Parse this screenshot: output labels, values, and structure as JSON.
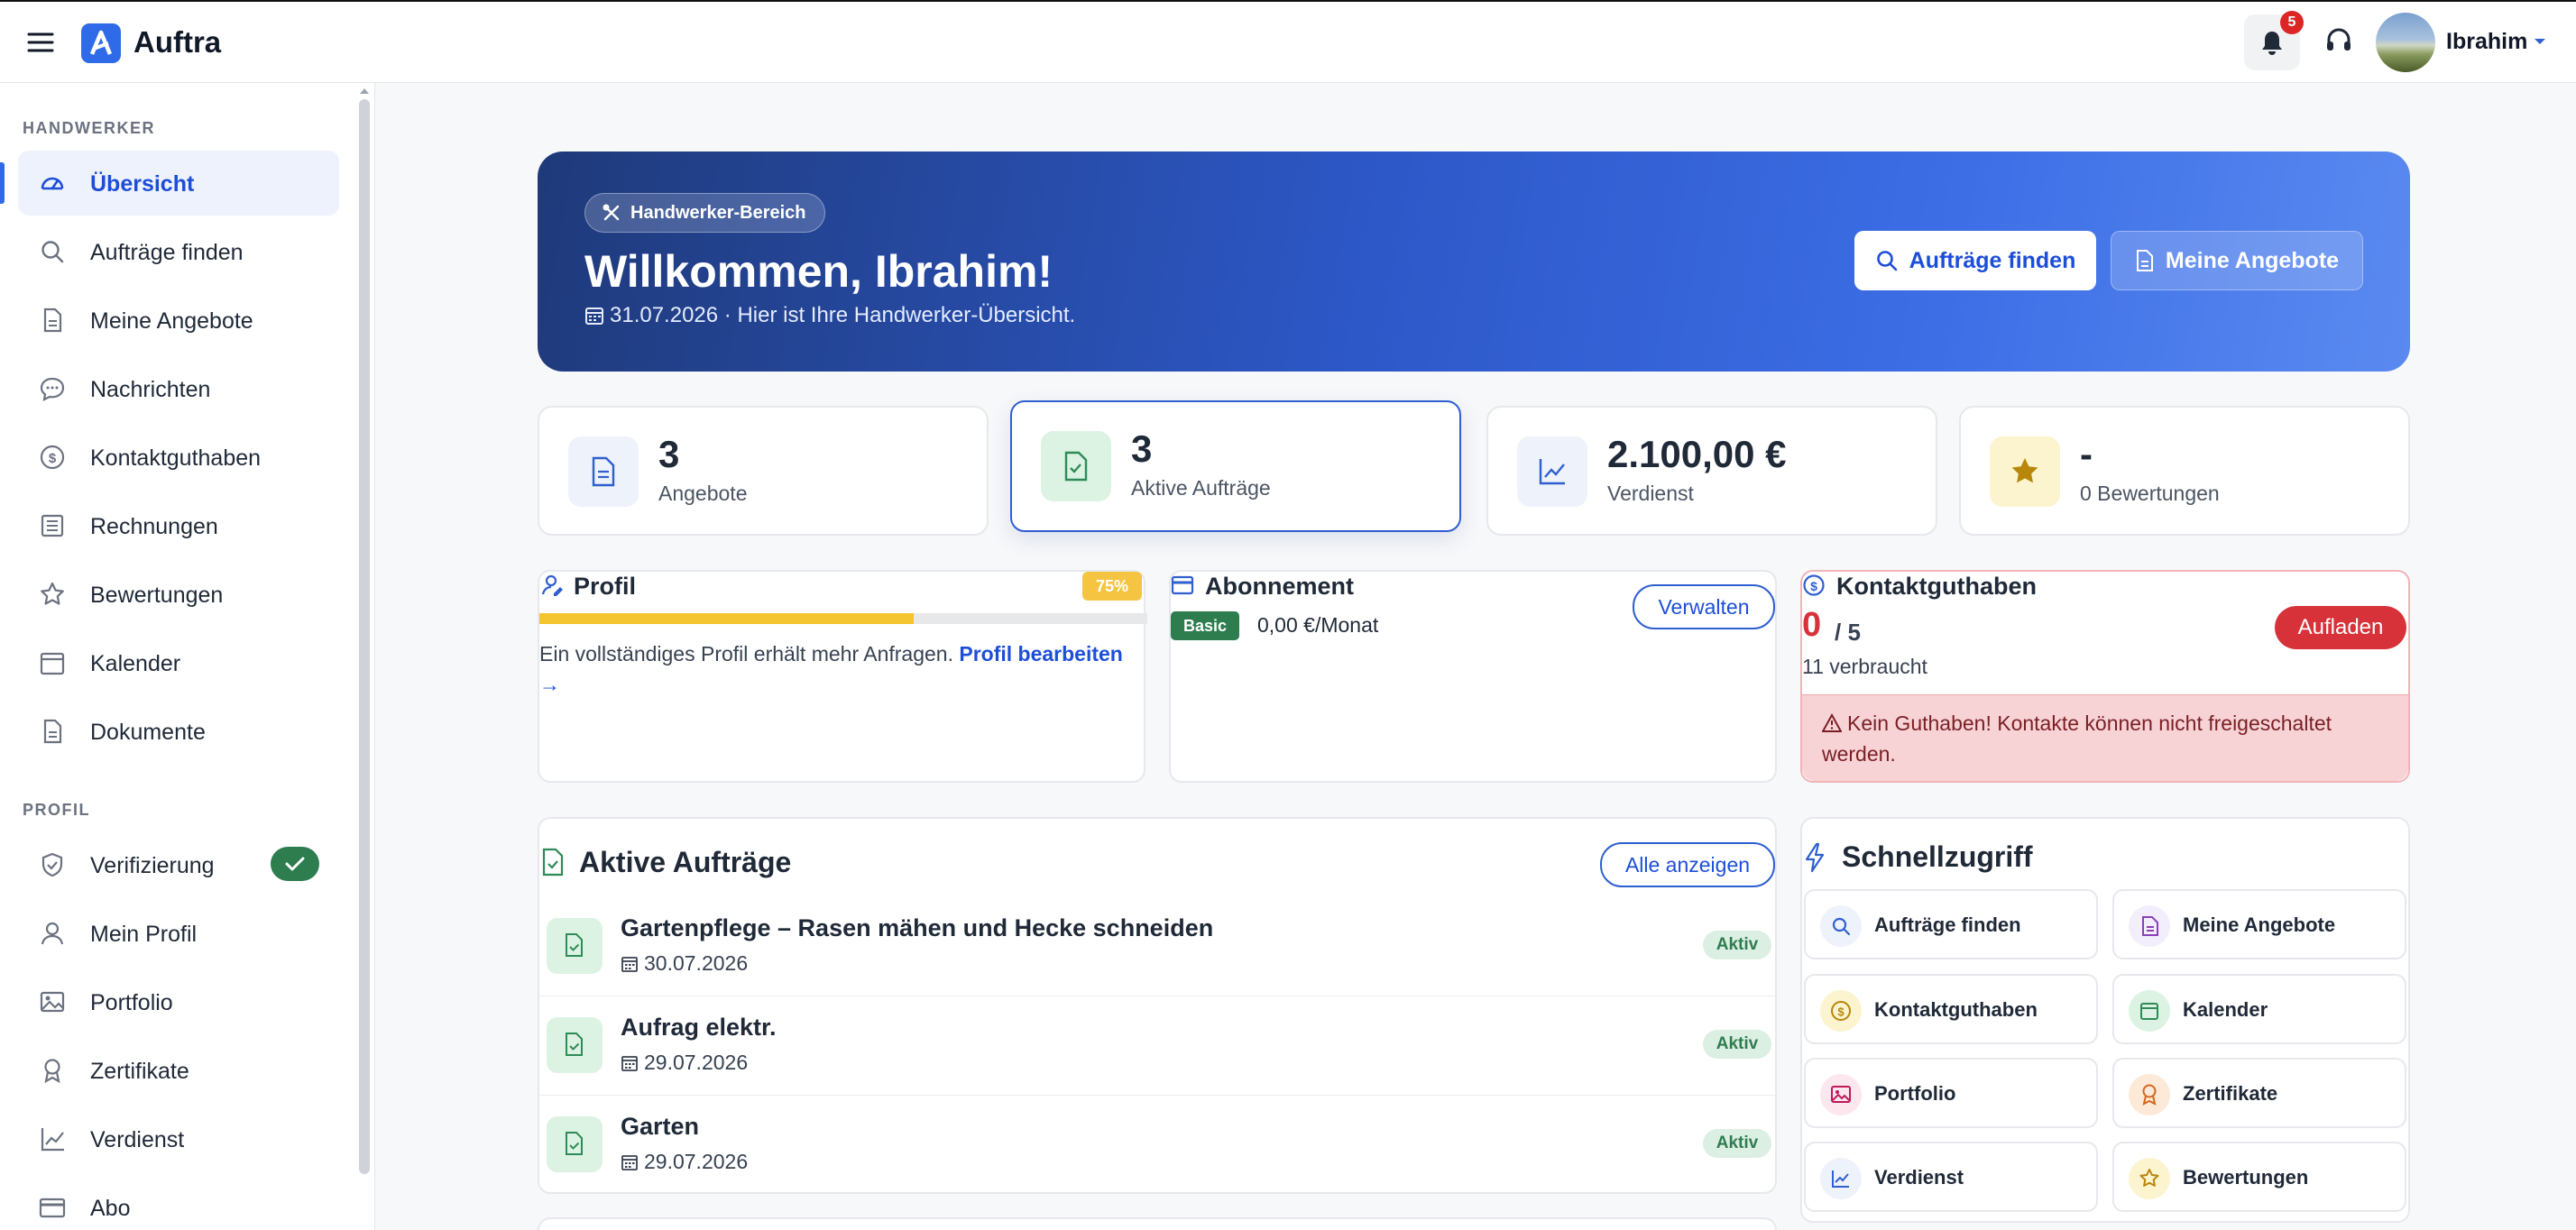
{
  "app": {
    "name": "Auftra",
    "notification_count": "5",
    "user_name": "Ibrahim"
  },
  "sidebar": {
    "sections": [
      {
        "label": "HANDWERKER",
        "items": [
          {
            "label": "Übersicht",
            "icon": "gauge-icon",
            "active": true
          },
          {
            "label": "Aufträge finden",
            "icon": "search-icon"
          },
          {
            "label": "Meine Angebote",
            "icon": "document-icon"
          },
          {
            "label": "Nachrichten",
            "icon": "chat-bubble-icon"
          },
          {
            "label": "Kontaktguthaben",
            "icon": "coin-icon"
          },
          {
            "label": "Rechnungen",
            "icon": "invoice-icon"
          },
          {
            "label": "Bewertungen",
            "icon": "star-icon"
          },
          {
            "label": "Kalender",
            "icon": "calendar-icon"
          },
          {
            "label": "Dokumente",
            "icon": "file-icon"
          }
        ]
      },
      {
        "label": "PROFIL",
        "items": [
          {
            "label": "Verifizierung",
            "icon": "shield-icon",
            "verified": true
          },
          {
            "label": "Mein Profil",
            "icon": "user-icon"
          },
          {
            "label": "Portfolio",
            "icon": "image-icon"
          },
          {
            "label": "Zertifikate",
            "icon": "award-icon"
          },
          {
            "label": "Verdienst",
            "icon": "chart-line-icon"
          },
          {
            "label": "Abo",
            "icon": "credit-card-icon"
          }
        ]
      }
    ]
  },
  "hero": {
    "chip": "Handwerker-Bereich",
    "title": "Willkommen, Ibrahim!",
    "subtitle": "31.07.2026 · Hier ist Ihre Handwerker-Übersicht.",
    "btn_find": "Aufträge finden",
    "btn_offers": "Meine Angebote"
  },
  "stats": [
    {
      "value": "3",
      "label": "Angebote",
      "icon": "document-icon"
    },
    {
      "value": "3",
      "label": "Aktive Aufträge",
      "icon": "file-check-icon"
    },
    {
      "value": "2.100,00 €",
      "label": "Verdienst",
      "icon": "chart-line-icon"
    },
    {
      "value": "-",
      "label": "0 Bewertungen",
      "icon": "star-icon"
    }
  ],
  "profile": {
    "title": "Profil",
    "percent_label": "75%",
    "completion": 0.75,
    "hint": "Ein vollständiges Profil erhält mehr Anfragen.",
    "link": "Profil bearbeiten",
    "arrow": "→"
  },
  "subscription": {
    "title": "Abonnement",
    "plan": "Basic",
    "price": "0,00 €/Monat",
    "manage": "Verwalten"
  },
  "credit": {
    "title": "Kontaktguthaben",
    "current": "0",
    "total": "/ 5",
    "used": "11 verbraucht",
    "topup": "Aufladen",
    "warning": "Kein Guthaben! Kontakte können nicht freigeschaltet werden."
  },
  "active_orders": {
    "title": "Aktive Aufträge",
    "show_all": "Alle anzeigen",
    "rows": [
      {
        "title": "Gartenpflege – Rasen mähen und Hecke schneiden",
        "date": "30.07.2026",
        "status": "Aktiv"
      },
      {
        "title": "Aufrag elektr.",
        "date": "29.07.2026",
        "status": "Aktiv"
      },
      {
        "title": "Garten",
        "date": "29.07.2026",
        "status": "Aktiv"
      }
    ]
  },
  "quick": {
    "title": "Schnellzugriff",
    "items": [
      {
        "label": "Aufträge finden",
        "icon": "search-icon",
        "color": "#eef2fb"
      },
      {
        "label": "Meine Angebote",
        "icon": "document-icon",
        "color": "#f3eefb"
      },
      {
        "label": "Kontaktguthaben",
        "icon": "coin-icon",
        "color": "#fbf4cf"
      },
      {
        "label": "Kalender",
        "icon": "calendar-icon",
        "color": "#dcf3e3"
      },
      {
        "label": "Portfolio",
        "icon": "image-icon",
        "color": "#fde7ee"
      },
      {
        "label": "Zertifikate",
        "icon": "award-icon",
        "color": "#fde9d7"
      },
      {
        "label": "Verdienst",
        "icon": "chart-line-icon",
        "color": "#eef2fb"
      },
      {
        "label": "Bewertungen",
        "icon": "star-icon",
        "color": "#fbf4cf"
      }
    ]
  }
}
